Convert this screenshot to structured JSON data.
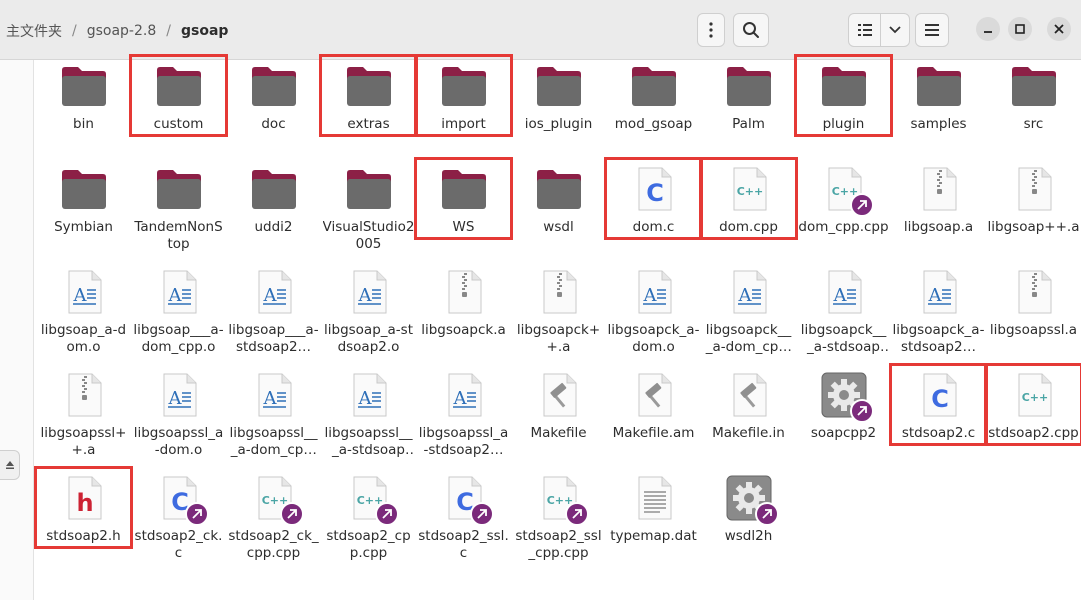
{
  "breadcrumb": {
    "items": [
      "主文件夹",
      "gsoap-2.8",
      "gsoap"
    ],
    "separator": "/"
  },
  "header": {
    "menu_icon": "more-vertical-icon",
    "search_icon": "search-icon",
    "view_icon": "list-view-icon",
    "view_dropdown_icon": "chevron-down-icon",
    "hamburger_icon": "hamburger-menu-icon",
    "minimize_icon": "minimize-icon",
    "maximize_icon": "maximize-icon",
    "close_icon": "close-icon"
  },
  "colors": {
    "folder": "#6b6b6b",
    "folder_tab": "#8c2046",
    "highlight": "#e53935",
    "c_blue": "#3e6be0",
    "cpp_teal": "#4aa5a5",
    "header_red": "#cc2233",
    "badge": "#7b2a7b"
  },
  "files": [
    {
      "name": "bin",
      "type": "folder",
      "highlight": false
    },
    {
      "name": "custom",
      "type": "folder",
      "highlight": true
    },
    {
      "name": "doc",
      "type": "folder",
      "highlight": false
    },
    {
      "name": "extras",
      "type": "folder",
      "highlight": true
    },
    {
      "name": "import",
      "type": "folder",
      "highlight": true
    },
    {
      "name": "ios_plugin",
      "type": "folder",
      "highlight": false
    },
    {
      "name": "mod_gsoap",
      "type": "folder",
      "highlight": false
    },
    {
      "name": "Palm",
      "type": "folder",
      "highlight": false
    },
    {
      "name": "plugin",
      "type": "folder",
      "highlight": true
    },
    {
      "name": "samples",
      "type": "folder",
      "highlight": false
    },
    {
      "name": "src",
      "type": "folder",
      "highlight": false
    },
    {
      "name": "Symbian",
      "type": "folder",
      "highlight": false
    },
    {
      "name": "TandemNonStop",
      "type": "folder",
      "highlight": false
    },
    {
      "name": "uddi2",
      "type": "folder",
      "highlight": false
    },
    {
      "name": "VisualStudio2005",
      "type": "folder",
      "highlight": false
    },
    {
      "name": "WS",
      "type": "folder",
      "highlight": true
    },
    {
      "name": "wsdl",
      "type": "folder",
      "highlight": false
    },
    {
      "name": "dom.c",
      "type": "c",
      "highlight": true
    },
    {
      "name": "dom.cpp",
      "type": "cpp",
      "highlight": true
    },
    {
      "name": "dom_cpp.cpp",
      "type": "cpp",
      "link": true,
      "highlight": false
    },
    {
      "name": "libgsoap.a",
      "type": "archive",
      "highlight": false
    },
    {
      "name": "libgsoap++.a",
      "type": "archive",
      "highlight": false
    },
    {
      "name": "libgsoap_a-dom.o",
      "type": "object",
      "highlight": false
    },
    {
      "name": "libgsoap___a-dom_cpp.o",
      "type": "object",
      "highlight": false
    },
    {
      "name": "libgsoap___a-stdsoap2…",
      "type": "object",
      "highlight": false
    },
    {
      "name": "libgsoap_a-stdsoap2.o",
      "type": "object",
      "highlight": false
    },
    {
      "name": "libgsoapck.a",
      "type": "archive",
      "highlight": false
    },
    {
      "name": "libgsoapck++.a",
      "type": "archive",
      "highlight": false
    },
    {
      "name": "libgsoapck_a-dom.o",
      "type": "object",
      "highlight": false
    },
    {
      "name": "libgsoapck___a-dom_cpp.o",
      "type": "object",
      "highlight": false
    },
    {
      "name": "libgsoapck___a-stdsoap2…",
      "type": "object",
      "highlight": false
    },
    {
      "name": "libgsoapck_a-stdsoap2…",
      "type": "object",
      "highlight": false
    },
    {
      "name": "libgsoapssl.a",
      "type": "archive",
      "highlight": false
    },
    {
      "name": "libgsoapssl++.a",
      "type": "archive",
      "highlight": false
    },
    {
      "name": "libgsoapssl_a-dom.o",
      "type": "object",
      "highlight": false
    },
    {
      "name": "libgsoapssl___a-dom_cpp.o",
      "type": "object",
      "highlight": false
    },
    {
      "name": "libgsoapssl___a-stdsoap2…",
      "type": "object",
      "highlight": false
    },
    {
      "name": "libgsoapssl_a-stdsoap2…",
      "type": "object",
      "highlight": false
    },
    {
      "name": "Makefile",
      "type": "make",
      "highlight": false
    },
    {
      "name": "Makefile.am",
      "type": "make",
      "highlight": false
    },
    {
      "name": "Makefile.in",
      "type": "make",
      "highlight": false
    },
    {
      "name": "soapcpp2",
      "type": "exec",
      "link": true,
      "highlight": false
    },
    {
      "name": "stdsoap2.c",
      "type": "c",
      "highlight": true
    },
    {
      "name": "stdsoap2.cpp",
      "type": "cpp",
      "highlight": true
    },
    {
      "name": "stdsoap2.h",
      "type": "h",
      "highlight": true
    },
    {
      "name": "stdsoap2_ck.c",
      "type": "c",
      "link": true,
      "highlight": false
    },
    {
      "name": "stdsoap2_ck_cpp.cpp",
      "type": "cpp",
      "link": true,
      "highlight": false
    },
    {
      "name": "stdsoap2_cpp.cpp",
      "type": "cpp",
      "link": true,
      "highlight": false
    },
    {
      "name": "stdsoap2_ssl.c",
      "type": "c",
      "link": true,
      "highlight": false
    },
    {
      "name": "stdsoap2_ssl_cpp.cpp",
      "type": "cpp",
      "link": true,
      "highlight": false
    },
    {
      "name": "typemap.dat",
      "type": "text",
      "highlight": false
    },
    {
      "name": "wsdl2h",
      "type": "exec",
      "link": true,
      "highlight": false
    }
  ]
}
